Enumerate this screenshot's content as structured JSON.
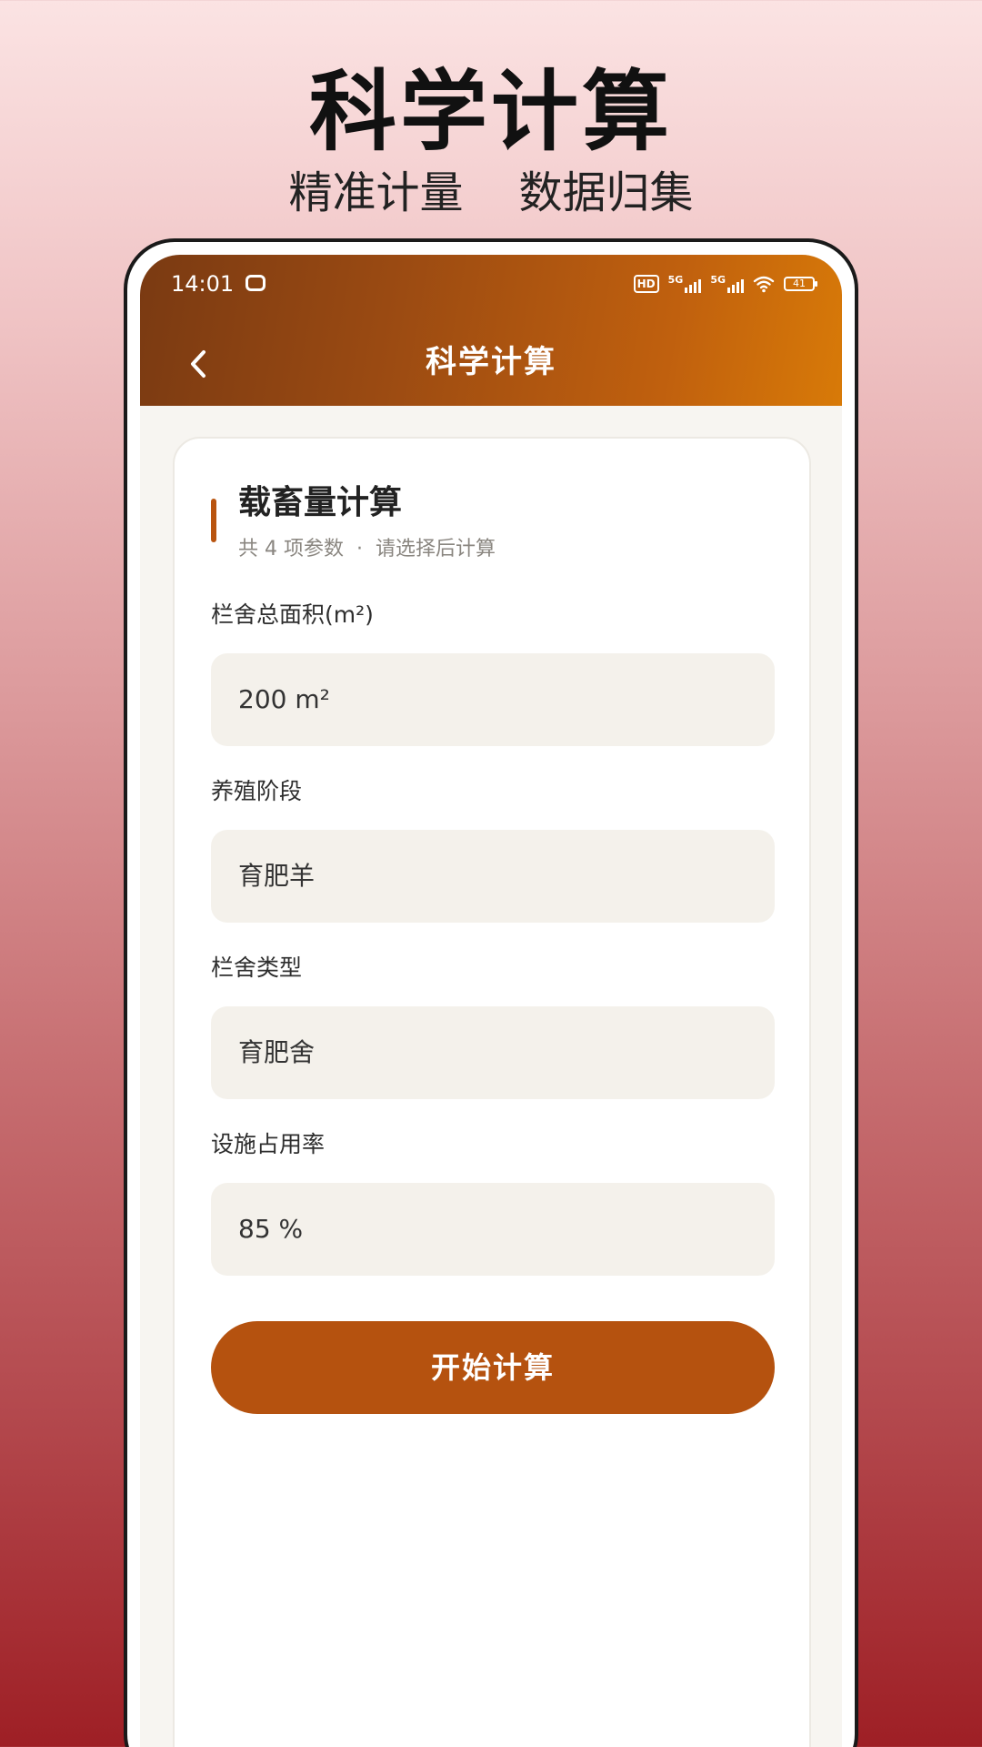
{
  "promo": {
    "title": "科学计算",
    "subtitle": "精准计量    数据归集"
  },
  "status_bar": {
    "time": "14:01",
    "hd_label": "HD",
    "signal1_label": "5G",
    "signal2_label": "5G",
    "battery": "41"
  },
  "header": {
    "title": "科学计算"
  },
  "card": {
    "title": "载畜量计算",
    "subtitle": "共 4 项参数  ·  请选择后计算"
  },
  "fields": [
    {
      "label": "栏舍总面积(m²)",
      "value": "200 m²"
    },
    {
      "label": "养殖阶段",
      "value": "育肥羊"
    },
    {
      "label": "栏舍类型",
      "value": "育肥舍"
    },
    {
      "label": "设施占用率",
      "value": "85 %"
    }
  ],
  "actions": {
    "start_label": "开始计算"
  },
  "colors": {
    "accent": "#b5520f",
    "header_gradient_start": "#7a3a12",
    "header_gradient_end": "#d87a08",
    "field_background": "#f4f1eb"
  },
  "icons": {
    "back": "chevron-left-icon",
    "wifi": "wifi-icon",
    "battery": "battery-icon"
  }
}
